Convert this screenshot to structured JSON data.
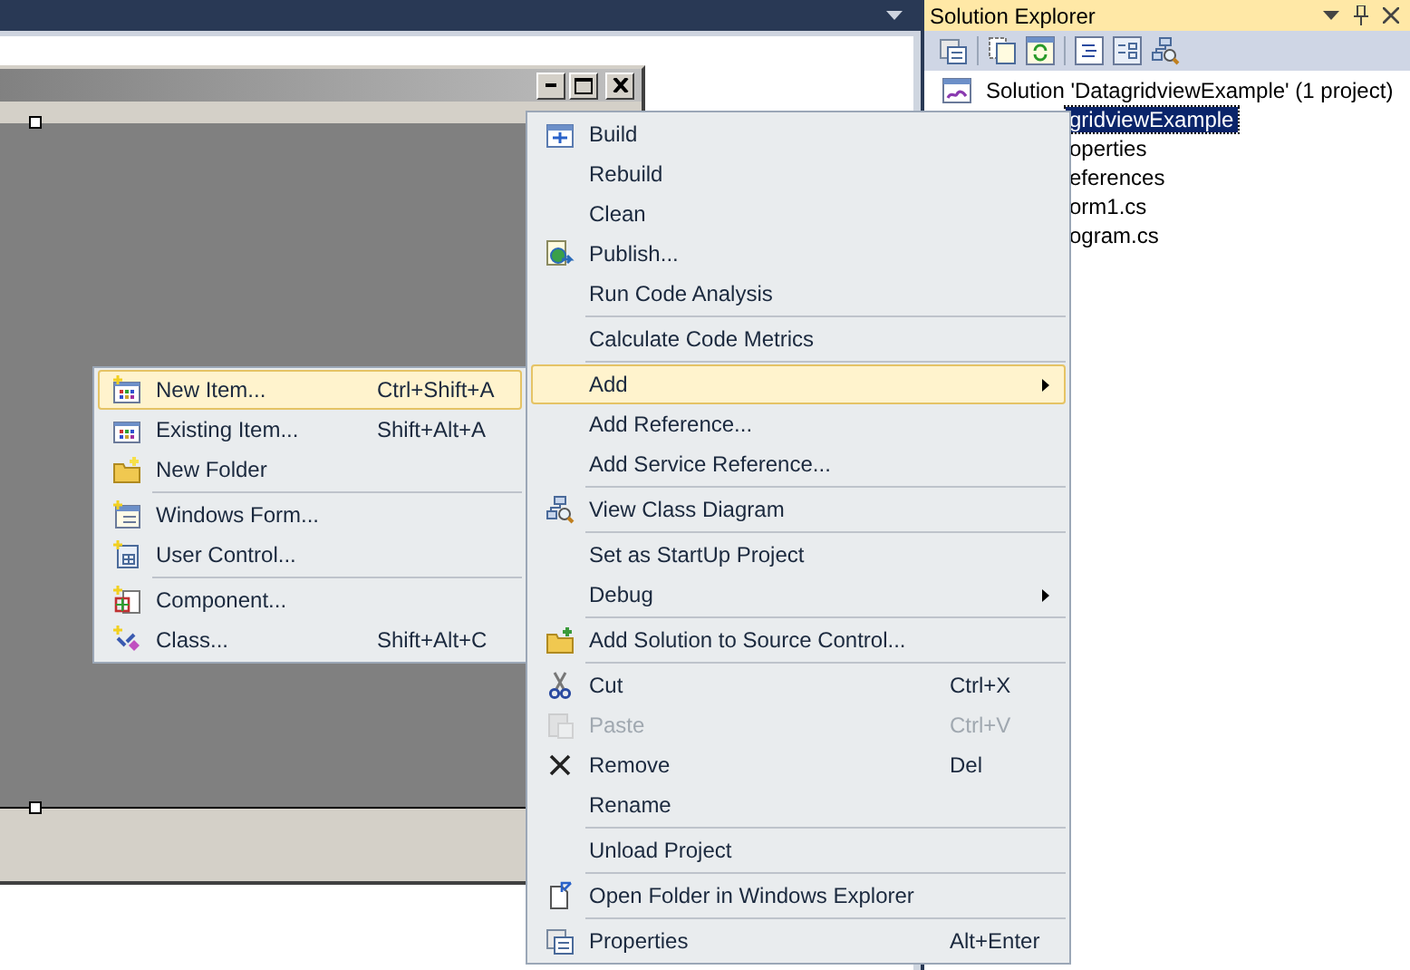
{
  "solution_explorer": {
    "title": "Solution Explorer",
    "tree": [
      {
        "label": "Solution 'DatagridviewExample' (1 project)",
        "selected": false,
        "children": [
          {
            "label": "gridviewExample",
            "selected": true,
            "children": [
              {
                "label": "operties",
                "selected": false
              },
              {
                "label": "eferences",
                "selected": false
              },
              {
                "label": "orm1.cs",
                "selected": false
              },
              {
                "label": "ogram.cs",
                "selected": false
              }
            ]
          }
        ]
      }
    ]
  },
  "context_menu": {
    "items": [
      {
        "kind": "item",
        "label": "Build",
        "selected": false,
        "disabled": false
      },
      {
        "kind": "item",
        "label": "Rebuild",
        "selected": false,
        "disabled": false
      },
      {
        "kind": "item",
        "label": "Clean",
        "selected": false,
        "disabled": false
      },
      {
        "kind": "item",
        "label": "Publish...",
        "selected": false,
        "disabled": false
      },
      {
        "kind": "item",
        "label": "Run Code Analysis",
        "selected": false,
        "disabled": false
      },
      {
        "kind": "separator"
      },
      {
        "kind": "item",
        "label": "Calculate Code Metrics",
        "selected": false,
        "disabled": false
      },
      {
        "kind": "separator"
      },
      {
        "kind": "item",
        "label": "Add",
        "submenu": true,
        "selected": true,
        "disabled": false
      },
      {
        "kind": "item",
        "label": "Add Reference...",
        "selected": false,
        "disabled": false
      },
      {
        "kind": "item",
        "label": "Add Service Reference...",
        "selected": false,
        "disabled": false
      },
      {
        "kind": "separator"
      },
      {
        "kind": "item",
        "label": "View Class Diagram",
        "selected": false,
        "disabled": false
      },
      {
        "kind": "separator"
      },
      {
        "kind": "item",
        "label": "Set as StartUp Project",
        "selected": false,
        "disabled": false
      },
      {
        "kind": "item",
        "label": "Debug",
        "submenu": true,
        "selected": false,
        "disabled": false
      },
      {
        "kind": "separator"
      },
      {
        "kind": "item",
        "label": "Add Solution to Source Control...",
        "selected": false,
        "disabled": false
      },
      {
        "kind": "separator"
      },
      {
        "kind": "item",
        "label": "Cut",
        "shortcut": "Ctrl+X",
        "selected": false,
        "disabled": false
      },
      {
        "kind": "item",
        "label": "Paste",
        "shortcut": "Ctrl+V",
        "selected": false,
        "disabled": true
      },
      {
        "kind": "item",
        "label": "Remove",
        "shortcut": "Del",
        "selected": false,
        "disabled": false
      },
      {
        "kind": "item",
        "label": "Rename",
        "selected": false,
        "disabled": false
      },
      {
        "kind": "separator"
      },
      {
        "kind": "item",
        "label": "Unload Project",
        "selected": false,
        "disabled": false
      },
      {
        "kind": "separator"
      },
      {
        "kind": "item",
        "label": "Open Folder in Windows Explorer",
        "selected": false,
        "disabled": false
      },
      {
        "kind": "separator"
      },
      {
        "kind": "item",
        "label": "Properties",
        "shortcut": "Alt+Enter",
        "selected": false,
        "disabled": false
      }
    ]
  },
  "add_submenu": {
    "items": [
      {
        "kind": "item",
        "label": "New Item...",
        "shortcut": "Ctrl+Shift+A",
        "selected": true,
        "disabled": false
      },
      {
        "kind": "item",
        "label": "Existing Item...",
        "shortcut": "Shift+Alt+A",
        "selected": false,
        "disabled": false
      },
      {
        "kind": "item",
        "label": "New Folder",
        "selected": false,
        "disabled": false
      },
      {
        "kind": "separator"
      },
      {
        "kind": "item",
        "label": "Windows Form...",
        "selected": false,
        "disabled": false
      },
      {
        "kind": "item",
        "label": "User Control...",
        "selected": false,
        "disabled": false
      },
      {
        "kind": "separator"
      },
      {
        "kind": "item",
        "label": "Component...",
        "selected": false,
        "disabled": false
      },
      {
        "kind": "item",
        "label": "Class...",
        "shortcut": "Shift+Alt+C",
        "selected": false,
        "disabled": false
      }
    ]
  }
}
